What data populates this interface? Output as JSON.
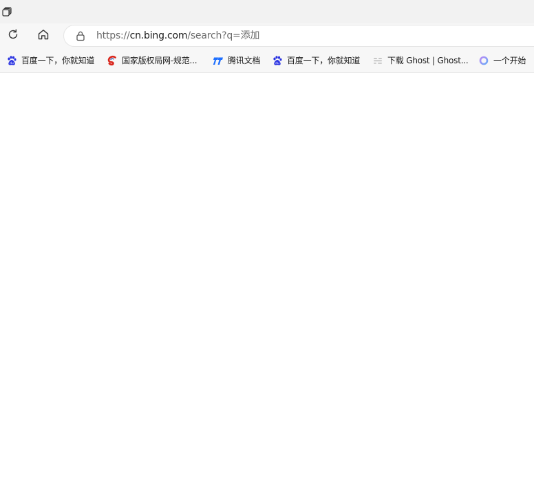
{
  "window": {
    "tab_actions_icon": "tab-actions-icon"
  },
  "toolbar": {
    "refresh_icon": "refresh-icon",
    "home_icon": "home-icon",
    "address": {
      "lock_icon": "lock-icon",
      "url_scheme": "https://",
      "url_host": "cn.bing.com",
      "url_rest": "/search?q=添加"
    }
  },
  "bookmarks": [
    {
      "label": "百度一下，你就知道",
      "icon": "baidu-paw-icon"
    },
    {
      "label": "国家版权局网-规范...",
      "icon": "copyright-logo-icon"
    },
    {
      "label": "腾讯文档",
      "icon": "tencent-docs-icon"
    },
    {
      "label": "百度一下，你就知道",
      "icon": "baidu-paw-icon"
    },
    {
      "label": "下载 Ghost | Ghost...",
      "icon": "ghost-lines-icon"
    },
    {
      "label": "一个开始",
      "icon": "ring-icon"
    }
  ],
  "colors": {
    "tabstrip_bg": "#f2f2f2",
    "toolbar_bg": "#f7f7f7",
    "baidu_blue": "#2932e1",
    "copyright_red": "#d9261c",
    "tencent_blue": "#1e6fff"
  }
}
